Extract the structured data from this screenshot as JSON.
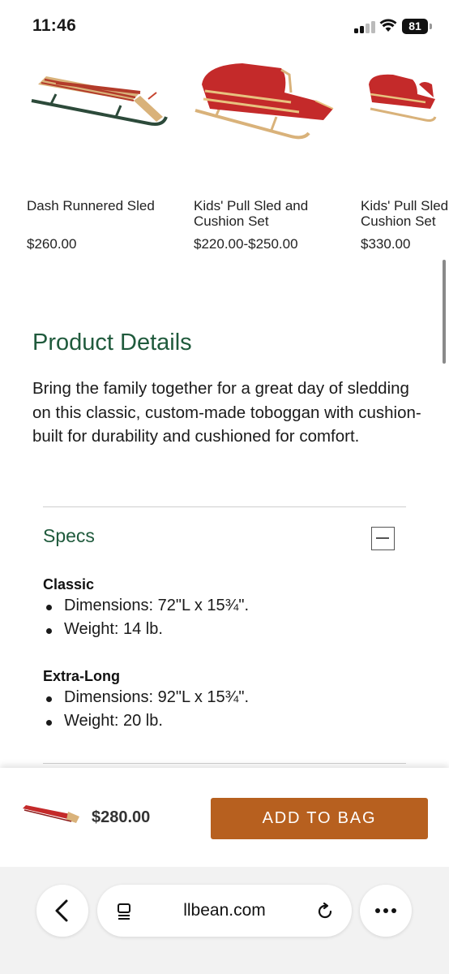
{
  "status_bar": {
    "time": "11:46",
    "battery": "81"
  },
  "carousel": {
    "products": [
      {
        "name": "Dash Runnered Sled",
        "price": "$260.00",
        "image_icon": "runner-sled-image"
      },
      {
        "name": "Kids' Pull Sled and Cushion Set",
        "price": "$220.00-$250.00",
        "image_icon": "pull-sled-image"
      },
      {
        "name": "Kids' Pull Sled and Cushion Set",
        "price": "$330.00",
        "image_icon": "pull-sled-image"
      }
    ]
  },
  "details": {
    "title": "Product Details",
    "description": "Bring the family together for a great day of sledding on this classic, custom-made toboggan with cushion-built for durability and cushioned for comfort."
  },
  "specs": {
    "header": "Specs",
    "groups": [
      {
        "title": "Classic",
        "items": [
          "Dimensions: 72\"L x 15¾\".",
          "Weight: 14 lb."
        ]
      },
      {
        "title": "Extra-Long",
        "items": [
          "Dimensions: 92\"L x 15¾\".",
          "Weight: 20 lb."
        ]
      }
    ]
  },
  "bag_bar": {
    "price": "$280.00",
    "button_label": "ADD TO BAG"
  },
  "browser": {
    "url": "llbean.com"
  },
  "colors": {
    "brand_green": "#1f5a3c",
    "button_orange": "#b7601f",
    "sled_red": "#c42a2a",
    "wood": "#d9b27a"
  }
}
